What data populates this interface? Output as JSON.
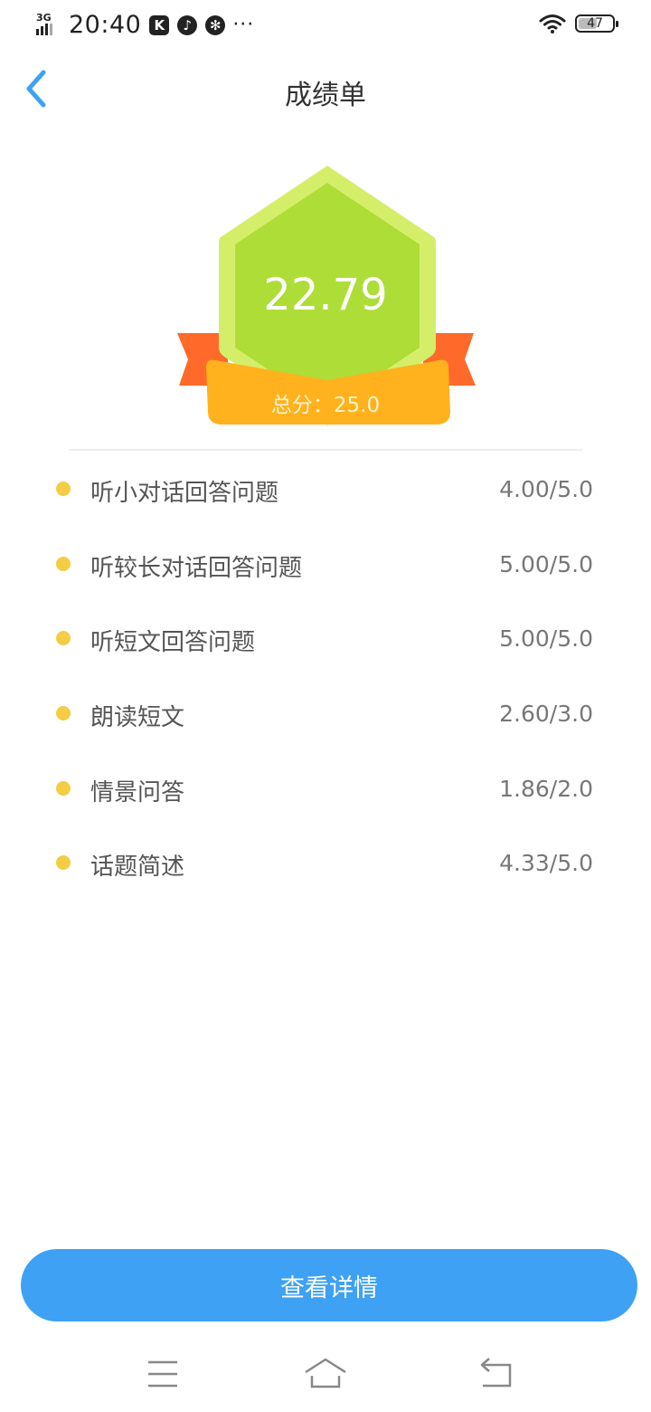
{
  "status_bar": {
    "network": "3G",
    "time": "20:40",
    "app_icon_k": "K",
    "more": "···",
    "battery": "47"
  },
  "header": {
    "title": "成绩单"
  },
  "badge": {
    "score": "22.79",
    "total": "总分：25.0",
    "colors": {
      "hexagon_outer": "#d4ee6a",
      "hexagon_inner": "#aedd38",
      "ribbon": "#ff6a2a",
      "banner": "#ffb21d"
    }
  },
  "score_items": [
    {
      "name": "听小对话回答问题",
      "score": "4.00/5.0"
    },
    {
      "name": "听较长对话回答问题",
      "score": "5.00/5.0"
    },
    {
      "name": "听短文回答问题",
      "score": "5.00/5.0"
    },
    {
      "name": "朗读短文",
      "score": "2.60/3.0"
    },
    {
      "name": "情景问答",
      "score": "1.86/2.0"
    },
    {
      "name": "话题简述",
      "score": "4.33/5.0"
    }
  ],
  "footer": {
    "details_button": "查看详情"
  },
  "colors": {
    "accent": "#3ea1f3",
    "bullet": "#f4cd45"
  }
}
